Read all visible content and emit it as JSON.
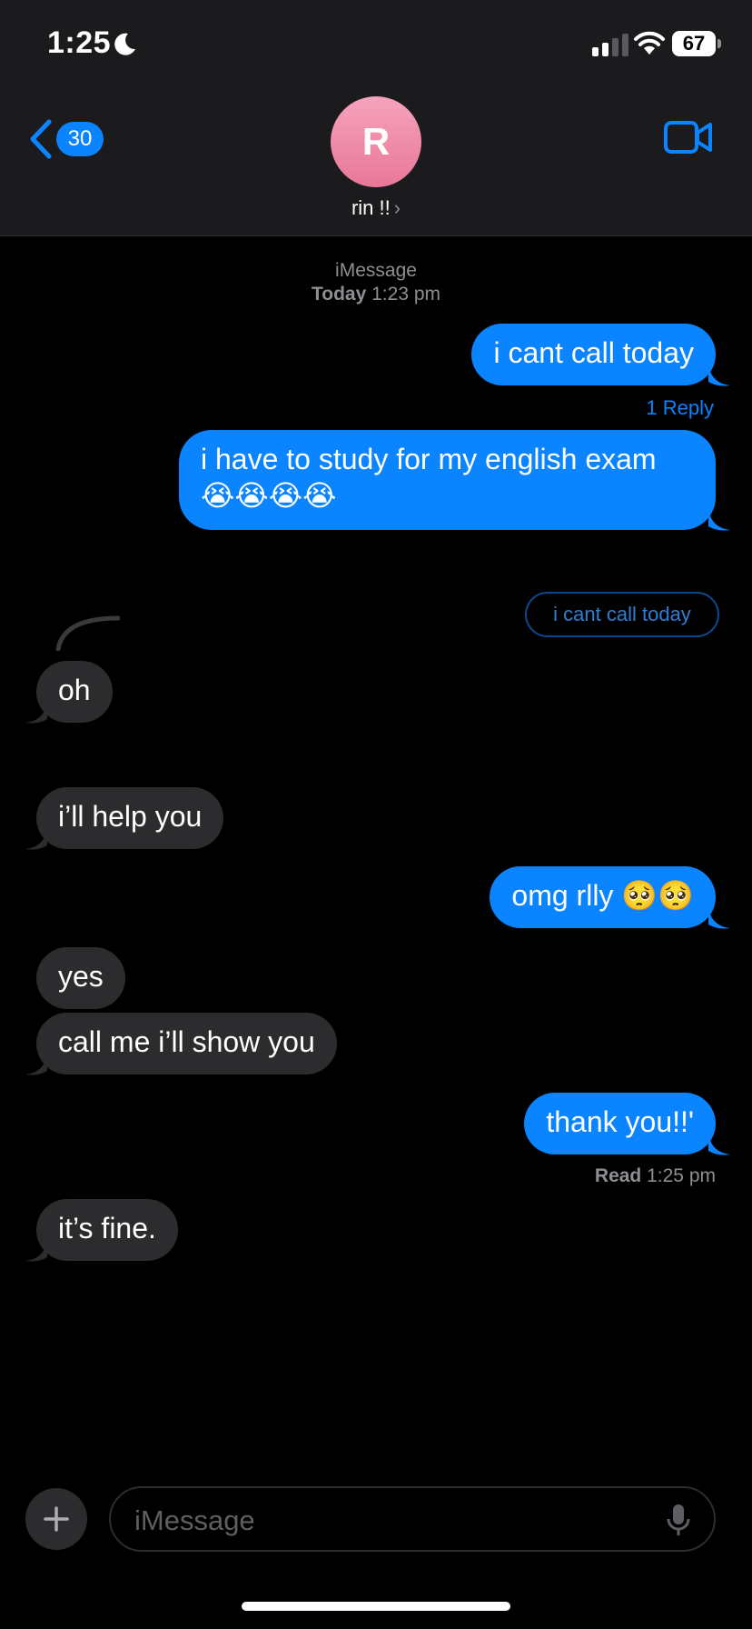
{
  "status_bar": {
    "time": "1:25",
    "battery": "67"
  },
  "header": {
    "back_count": "30",
    "avatar_initial": "R",
    "contact_name": "rin !!",
    "chevron": "›"
  },
  "conversation": {
    "service": "iMessage",
    "date_label": "Today",
    "date_time": "1:23 pm",
    "messages": [
      {
        "from": "me",
        "text": "i cant call today"
      },
      {
        "from": "me",
        "text": "i have to study for my english exam 😭😭😭😭"
      },
      {
        "from": "them",
        "text": "oh"
      },
      {
        "from": "them",
        "text": "i’ll help you"
      },
      {
        "from": "me",
        "text": "omg rlly 🥺🥺"
      },
      {
        "from": "them",
        "text": "yes"
      },
      {
        "from": "them",
        "text": "call me i’ll show you"
      },
      {
        "from": "me",
        "text": "thank you!!'"
      },
      {
        "from": "them",
        "text": "it’s fine."
      }
    ],
    "reply_link": "1 Reply",
    "quoted_reply": "i cant call today",
    "read_label": "Read",
    "read_time": "1:25 pm"
  },
  "composer": {
    "placeholder": "iMessage"
  },
  "colors": {
    "sent": "#0a84ff",
    "received": "#2c2c2e",
    "background": "#000000"
  }
}
